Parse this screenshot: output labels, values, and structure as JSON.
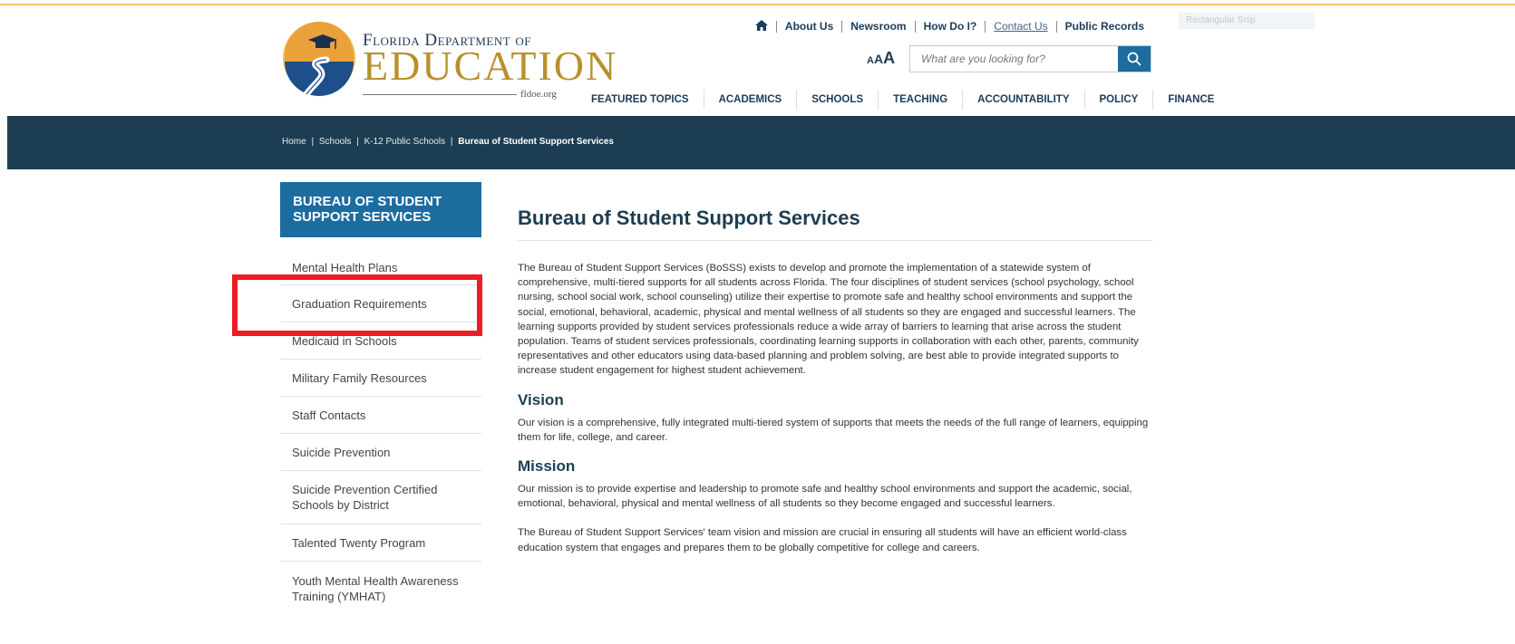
{
  "header": {
    "logo": {
      "line1": "Florida Department of",
      "line2": "EDUCATION",
      "url": "fldoe.org"
    },
    "utility": [
      {
        "label": "About Us"
      },
      {
        "label": "Newsroom"
      },
      {
        "label": "How Do I?"
      },
      {
        "label": "Contact Us"
      },
      {
        "label": "Public Records"
      }
    ],
    "text_size_label": {
      "a1": "A",
      "a2": "A",
      "a3": "A"
    },
    "search": {
      "placeholder": "What are you looking for?"
    },
    "nav": [
      {
        "label": "FEATURED TOPICS"
      },
      {
        "label": "ACADEMICS"
      },
      {
        "label": "SCHOOLS"
      },
      {
        "label": "TEACHING"
      },
      {
        "label": "ACCOUNTABILITY"
      },
      {
        "label": "POLICY"
      },
      {
        "label": "FINANCE"
      }
    ],
    "snip_tag": "Rectangular Snip"
  },
  "breadcrumb": [
    "Home",
    "Schools",
    "K-12 Public Schools",
    "Bureau of Student Support Services"
  ],
  "breadcrumb_separator": "|",
  "sidebar": {
    "title": "Bureau of Student Support Services",
    "items": [
      {
        "label": "Mental Health Plans"
      },
      {
        "label": "Graduation Requirements"
      },
      {
        "label": "Medicaid in Schools"
      },
      {
        "label": "Military Family Resources"
      },
      {
        "label": "Staff Contacts"
      },
      {
        "label": "Suicide Prevention"
      },
      {
        "label": "Suicide Prevention Certified Schools by District"
      },
      {
        "label": "Talented Twenty Program"
      },
      {
        "label": "Youth Mental Health Awareness Training (YMHAT)"
      }
    ]
  },
  "main": {
    "title": "Bureau of Student Support Services",
    "intro": "The Bureau of Student Support Services (BoSSS) exists to develop and promote the implementation of a statewide system of comprehensive, multi-tiered supports for all students across Florida. The four disciplines of student services (school psychology, school nursing, school social work, school counseling) utilize their expertise to promote safe and healthy school environments and support the social, emotional, behavioral, academic, physical and mental wellness of all students so they are engaged and successful learners. The learning supports provided by student services professionals reduce a wide array of barriers to learning that arise across the student population. Teams of student services professionals, coordinating learning supports in collaboration with each other, parents, community representatives and other educators using data-based planning and problem solving, are best able to provide integrated supports to increase student engagement for highest student achievement.",
    "vision_heading": "Vision",
    "vision_text": "Our vision is a comprehensive, fully integrated multi-tiered system of supports that meets the needs of the full range of learners, equipping them for life, college, and career.",
    "mission_heading": "Mission",
    "mission_text": "Our mission is to provide expertise and leadership to promote safe and healthy school environments and support the academic, social, emotional, behavioral, physical and mental wellness of all students so they become engaged and successful learners.",
    "closing_text": "The Bureau of Student Support Services' team vision and mission are crucial in ensuring all students will have an efficient world-class education system that engages and prepares them to be globally competitive for college and careers."
  },
  "colors": {
    "brand_blue": "#1c6ca0",
    "brand_navy": "#1d3e52",
    "brand_gold": "#b9902c",
    "highlight_red": "#ee1c25"
  }
}
